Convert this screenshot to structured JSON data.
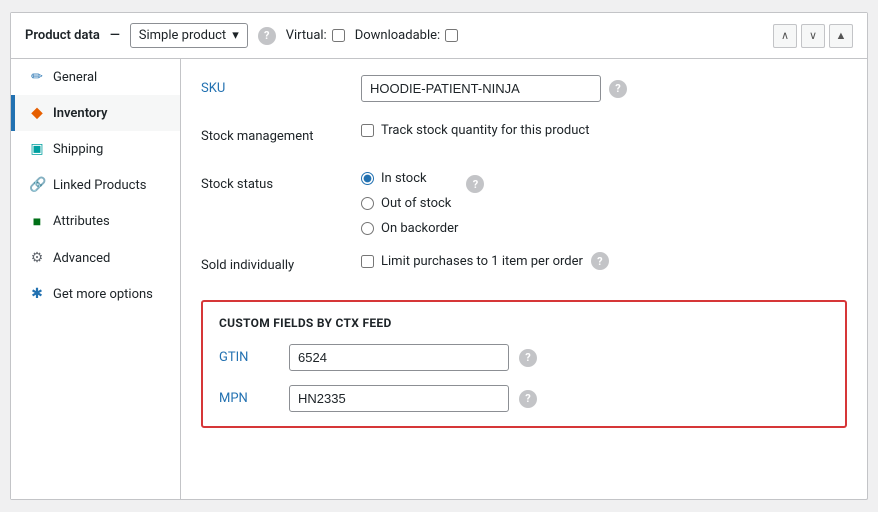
{
  "header": {
    "title": "Product data",
    "separator": "—",
    "product_type": "Simple product",
    "virtual_label": "Virtual:",
    "downloadable_label": "Downloadable:"
  },
  "sidebar": {
    "items": [
      {
        "id": "general",
        "label": "General",
        "icon": "✏",
        "icon_class": "blue",
        "active": false
      },
      {
        "id": "inventory",
        "label": "Inventory",
        "icon": "◆",
        "icon_class": "orange",
        "active": true
      },
      {
        "id": "shipping",
        "label": "Shipping",
        "icon": "📦",
        "icon_class": "teal",
        "active": false
      },
      {
        "id": "linked-products",
        "label": "Linked Products",
        "icon": "🔗",
        "icon_class": "blue",
        "active": false
      },
      {
        "id": "attributes",
        "label": "Attributes",
        "icon": "■",
        "icon_class": "green",
        "active": false
      },
      {
        "id": "advanced",
        "label": "Advanced",
        "icon": "⚙",
        "icon_class": "gray",
        "active": false
      },
      {
        "id": "get-more-options",
        "label": "Get more options",
        "icon": "✱",
        "icon_class": "blue",
        "active": false
      }
    ]
  },
  "main": {
    "sku": {
      "label": "SKU",
      "value": "HOODIE-PATIENT-NINJA"
    },
    "stock_management": {
      "label": "Stock management",
      "checkbox_label": "Track stock quantity for this product"
    },
    "stock_status": {
      "label": "Stock status",
      "options": [
        {
          "value": "in_stock",
          "label": "In stock",
          "selected": true
        },
        {
          "value": "out_of_stock",
          "label": "Out of stock",
          "selected": false
        },
        {
          "value": "on_backorder",
          "label": "On backorder",
          "selected": false
        }
      ]
    },
    "sold_individually": {
      "label": "Sold individually",
      "checkbox_label": "Limit purchases to 1 item per order"
    },
    "custom_fields": {
      "title": "CUSTOM FIELDS by CTX Feed",
      "gtin": {
        "label": "GTIN",
        "value": "6524"
      },
      "mpn": {
        "label": "MPN",
        "value": "HN2335"
      }
    }
  },
  "icons": {
    "question_mark": "?",
    "chevron_down": "▾",
    "chevron_up": "∧",
    "chevron_down_nav": "∨",
    "chevron_up_nav": "∧",
    "triangle_up": "▲"
  }
}
